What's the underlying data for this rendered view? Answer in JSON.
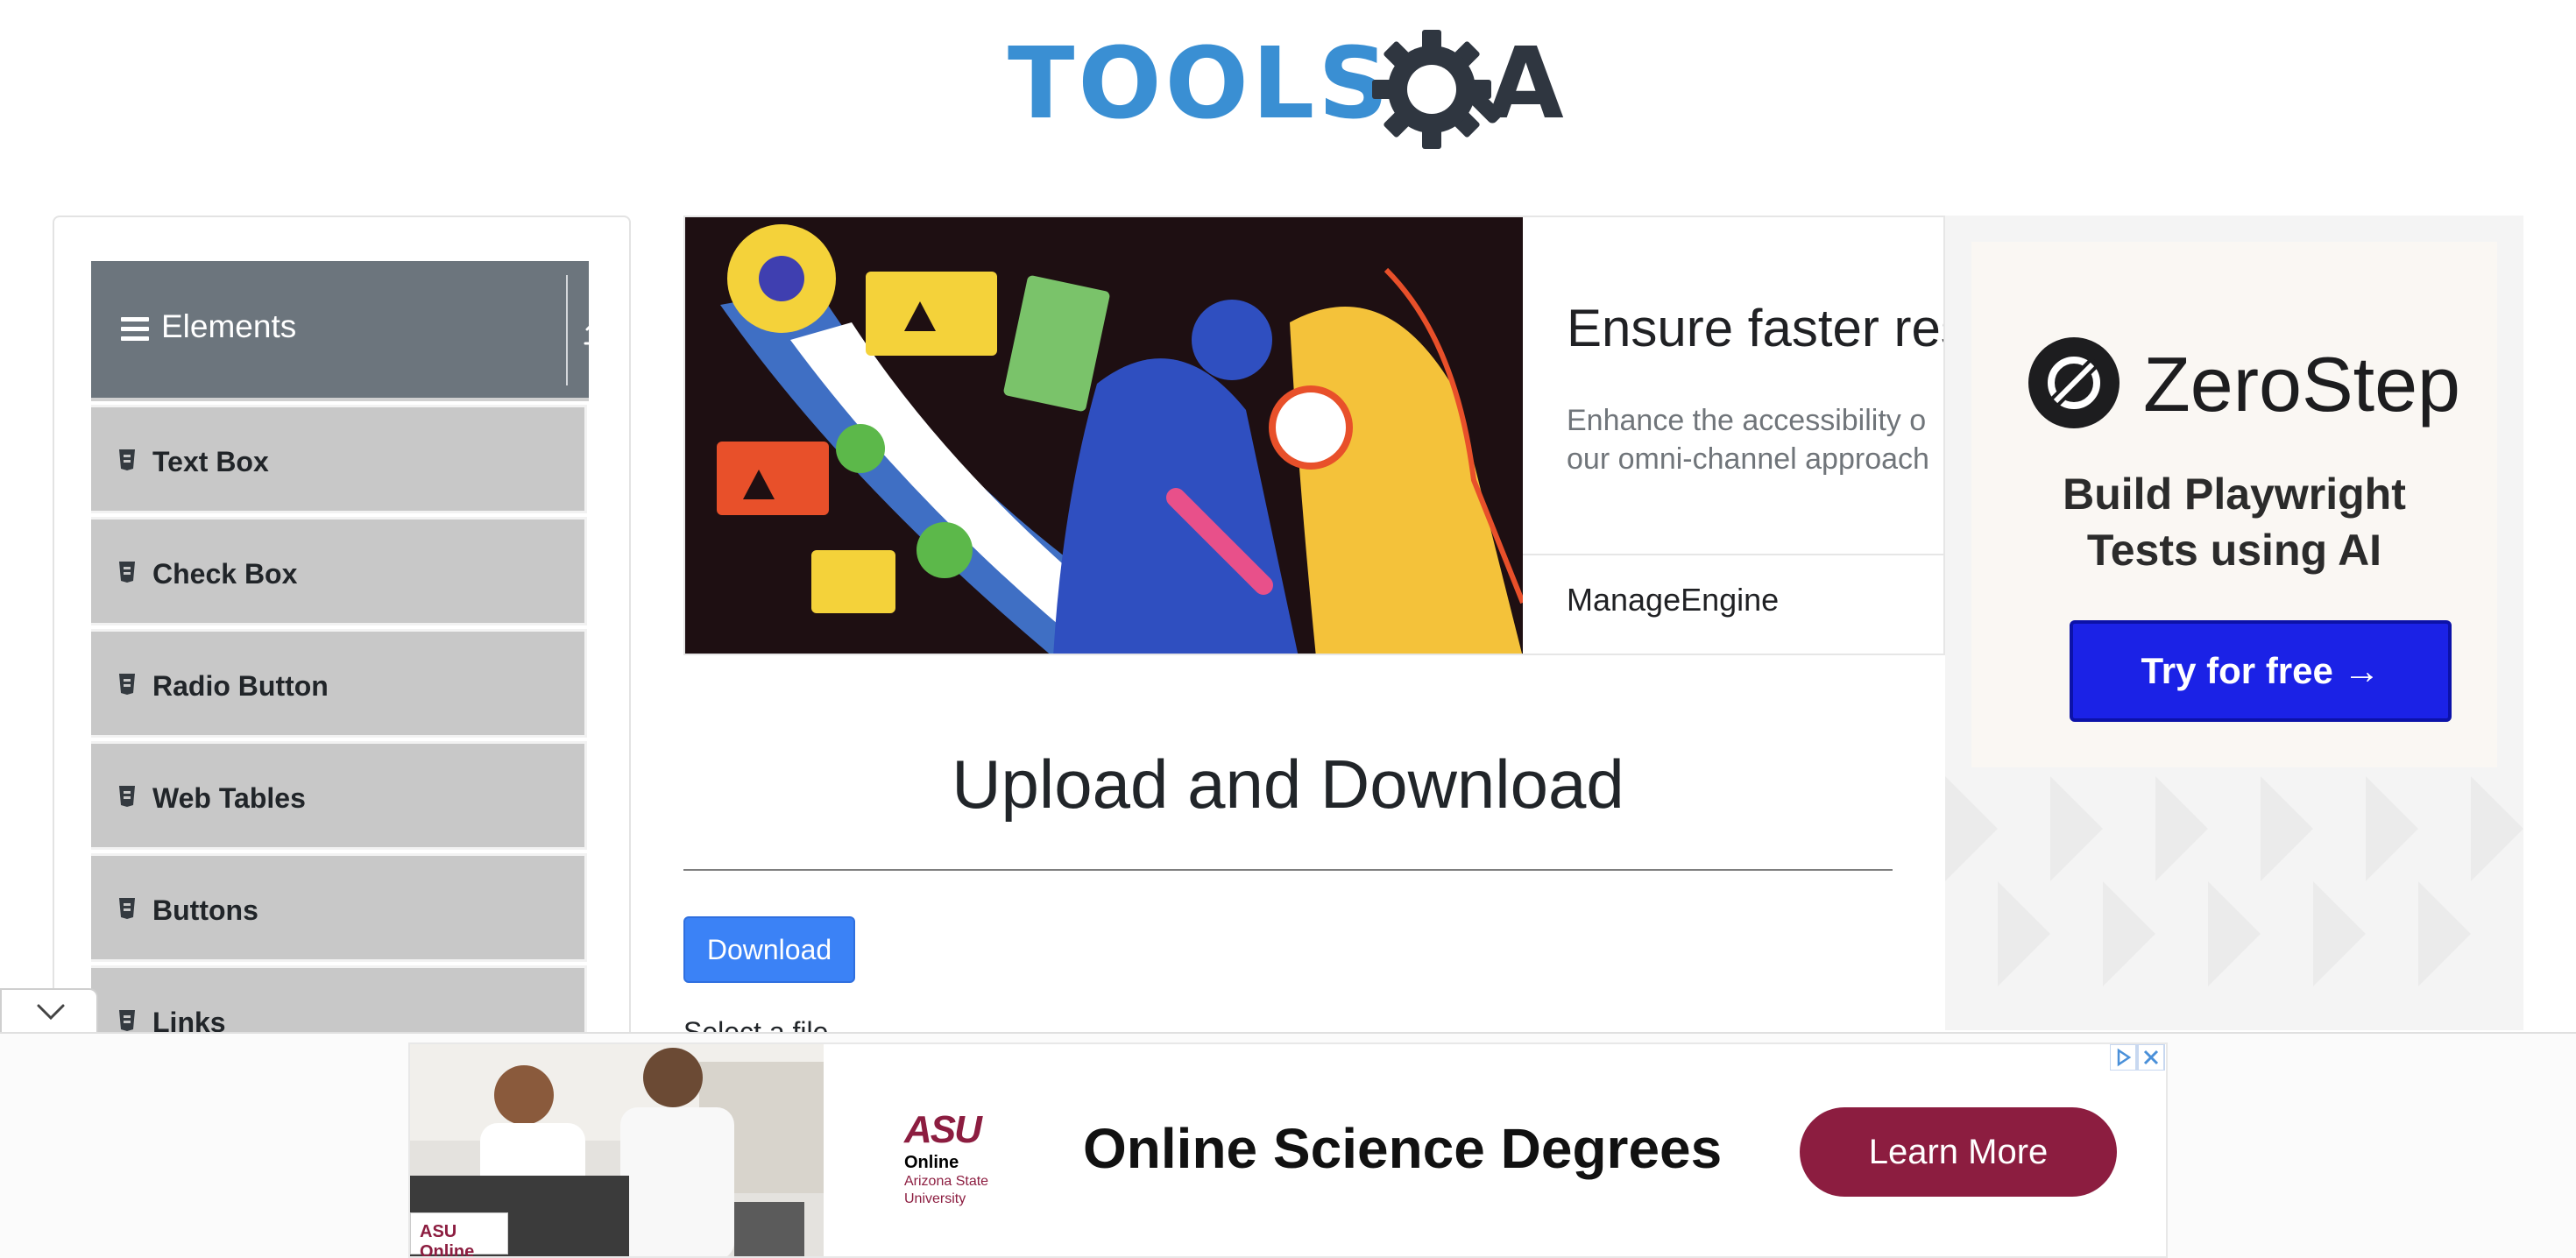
{
  "header": {
    "logo_text": "TOOLSQA",
    "logo_part_tools": "TOOLS",
    "logo_part_a": "A"
  },
  "sidebar": {
    "group_title": "Elements",
    "items": [
      {
        "label": "Text Box"
      },
      {
        "label": "Check Box"
      },
      {
        "label": "Radio Button"
      },
      {
        "label": "Web Tables"
      },
      {
        "label": "Buttons"
      },
      {
        "label": "Links"
      }
    ]
  },
  "top_ad": {
    "headline": "Ensure faster res",
    "body": "Enhance the accessibility o\nour omni-channel approach",
    "brand": "ManageEngine"
  },
  "right_ad": {
    "brand": "ZeroStep",
    "tagline_line1": "Build Playwright",
    "tagline_line2": "Tests using AI",
    "cta": "Try for free →"
  },
  "main": {
    "title": "Upload and Download",
    "download_label": "Download",
    "select_file_label": "Select a file"
  },
  "bottom_ad": {
    "photo_tag": "ASU Online",
    "school_logo": "ASU",
    "school_online": "Online",
    "school_name": "Arizona State University",
    "headline": "Online Science Degrees",
    "cta": "Learn More"
  },
  "colors": {
    "logo_blue": "#3a8fd3",
    "sidebar_header": "#6c757d",
    "menu_item_bg": "#c8c8c8",
    "primary_button": "#3b82f6",
    "zerostep_cta": "#1b22e6",
    "asu_maroon": "#8c1d40"
  },
  "icons": {
    "menu": "hamburger-icon",
    "collapse": "upload-arrow-icon",
    "item": "document-icon",
    "toggle": "chevron-down-icon",
    "ad_info": "ad-choices-icon",
    "ad_close": "close-icon"
  }
}
